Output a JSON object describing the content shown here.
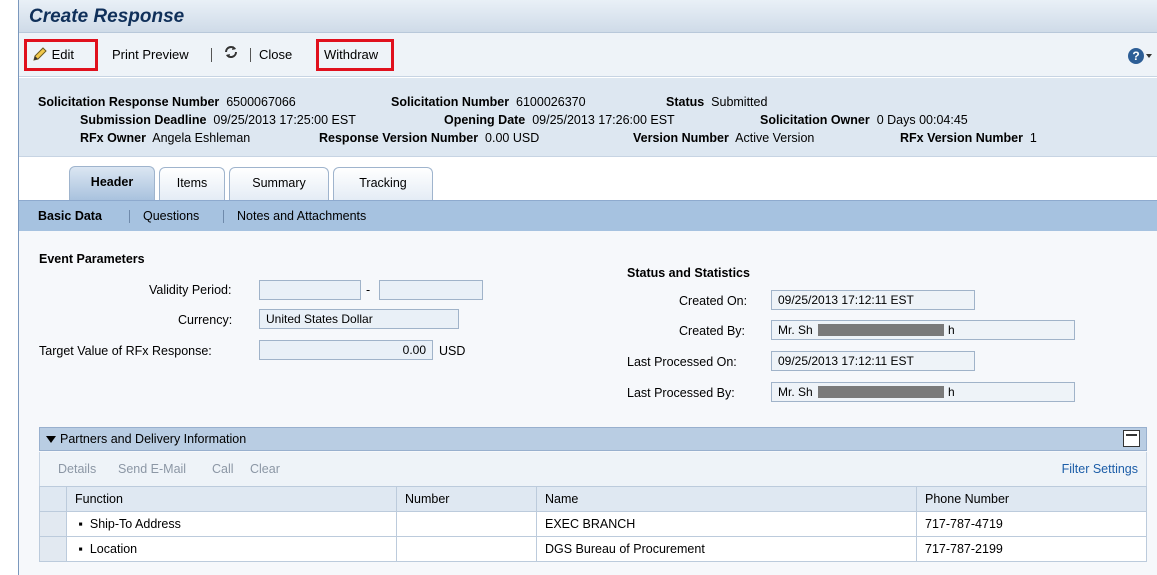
{
  "title": "Create Response",
  "toolbar": {
    "edit": "Edit",
    "print_preview": "Print Preview",
    "close": "Close",
    "withdraw": "Withdraw",
    "help": "?"
  },
  "info": {
    "resp_num_label": "Solicitation Response Number",
    "resp_num": "6500067066",
    "sol_num_label": "Solicitation Number",
    "sol_num": "6100026370",
    "status_label": "Status",
    "status": "Submitted",
    "deadline_label": "Submission Deadline",
    "deadline": "09/25/2013 17:25:00 EST",
    "opening_label": "Opening Date",
    "opening": "09/25/2013 17:26:00 EST",
    "owner_label": "Solicitation Owner",
    "owner": "0 Days 00:04:45",
    "rfx_owner_label": "RFx Owner",
    "rfx_owner": "Angela Eshleman",
    "resp_ver_label": "Response Version Number",
    "resp_ver": "0.00 USD",
    "ver_label": "Version Number",
    "ver": "Active Version",
    "rfx_ver_label": "RFx Version Number",
    "rfx_ver": "1"
  },
  "tabs": [
    "Header",
    "Items",
    "Summary",
    "Tracking"
  ],
  "subnav": [
    "Basic Data",
    "Questions",
    "Notes and Attachments"
  ],
  "event": {
    "heading": "Event Parameters",
    "validity_label": "Validity Period:",
    "validity_sep": "-",
    "currency_label": "Currency:",
    "currency": "United States Dollar",
    "target_label": "Target Value of RFx Response:",
    "target_value": "0.00",
    "target_unit": "USD"
  },
  "stats": {
    "heading": "Status and Statistics",
    "created_on_label": "Created On:",
    "created_on": "09/25/2013 17:12:11 EST",
    "created_by_label": "Created By:",
    "created_by_a": "Mr. Sh",
    "created_by_b": "h",
    "last_on_label": "Last Processed On:",
    "last_on": "09/25/2013 17:12:11 EST",
    "last_by_label": "Last Processed By:",
    "last_by_a": "Mr. Sh",
    "last_by_b": "h"
  },
  "partners": {
    "heading": "Partners and Delivery Information",
    "actions": [
      "Details",
      "Send E-Mail",
      "Call",
      "Clear"
    ],
    "filter": "Filter Settings",
    "columns": [
      "Function",
      "Number",
      "Name",
      "Phone Number"
    ],
    "rows": [
      {
        "function": "Ship-To Address",
        "number": "",
        "name": "EXEC BRANCH",
        "phone": "717-787-4719"
      },
      {
        "function": "Location",
        "number": "",
        "name": "DGS Bureau of Procurement",
        "phone": "717-787-2199"
      }
    ]
  }
}
